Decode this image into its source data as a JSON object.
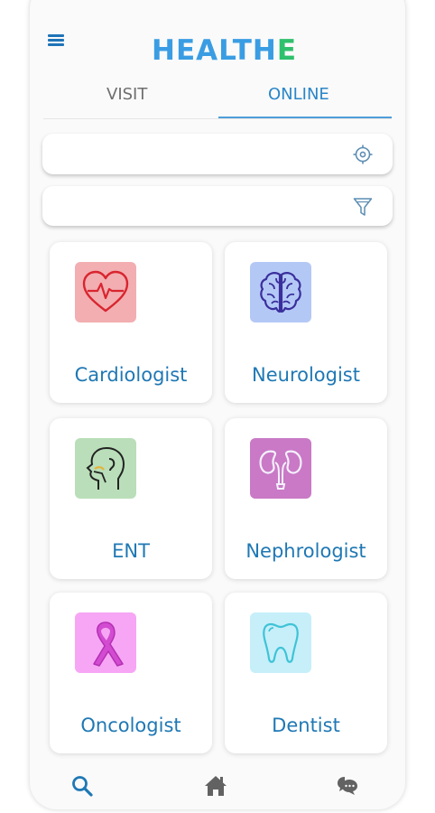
{
  "app": {
    "logo_main": "HEALTH",
    "logo_accent": "E"
  },
  "tabs": [
    {
      "label": "VISIT",
      "active": false
    },
    {
      "label": "ONLINE",
      "active": true
    }
  ],
  "search": {
    "value": "",
    "placeholder": "",
    "icon": "location-target-icon"
  },
  "filter": {
    "value": "",
    "placeholder": "",
    "icon": "filter-funnel-icon"
  },
  "specialties": [
    {
      "label": "Cardiologist",
      "icon": "heart-icon",
      "color": "#f2aeb1"
    },
    {
      "label": "Neurologist",
      "icon": "brain-icon",
      "color": "#b4c8f6"
    },
    {
      "label": "ENT",
      "icon": "head-profile-icon",
      "color": "#b9deb9"
    },
    {
      "label": "Nephrologist",
      "icon": "kidney-icon",
      "color": "#c979c5"
    },
    {
      "label": "Oncologist",
      "icon": "cancer-ribbon-icon",
      "color": "#f6a6f4"
    },
    {
      "label": "Dentist",
      "icon": "tooth-icon",
      "color": "#c6effa"
    }
  ],
  "bottom_nav": [
    {
      "icon": "search-icon",
      "active": true
    },
    {
      "icon": "home-icon",
      "active": false
    },
    {
      "icon": "chat-icon",
      "active": false
    }
  ],
  "colors": {
    "accent": "#1f78b4",
    "logo_blue": "#3a9de3",
    "logo_green": "#2fc06d",
    "tab_inactive": "#6e6e6e"
  }
}
